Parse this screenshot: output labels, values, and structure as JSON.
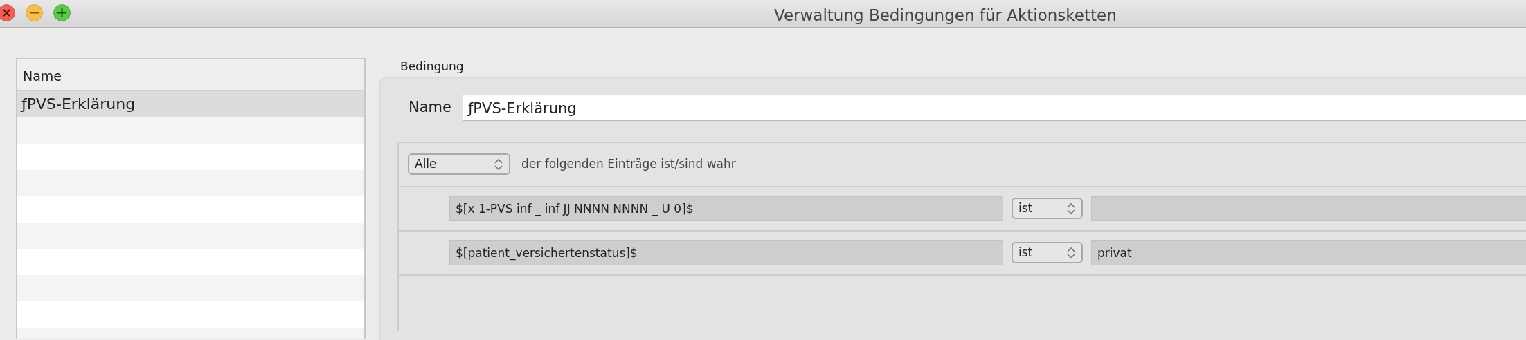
{
  "window": {
    "title": "Verwaltung Bedingungen für Aktionsketten"
  },
  "list": {
    "column": "Name",
    "items": [
      {
        "label": "ƒPVS-Erklärung",
        "selected": true
      }
    ]
  },
  "condition": {
    "group_title": "Bedingung",
    "name_label": "Name",
    "name_value": "ƒPVS-Erklärung",
    "quantifier": "Alle",
    "quantifier_text": "der folgenden Einträge ist/sind wahr",
    "rules": [
      {
        "variable": "$[x 1-PVS inf _ inf JJ NNNN NNNN _ U 0]$",
        "operator": "ist"
      },
      {
        "variable": "$[patient_versichertenstatus]$",
        "operator": "ist",
        "value": "privat"
      }
    ]
  }
}
